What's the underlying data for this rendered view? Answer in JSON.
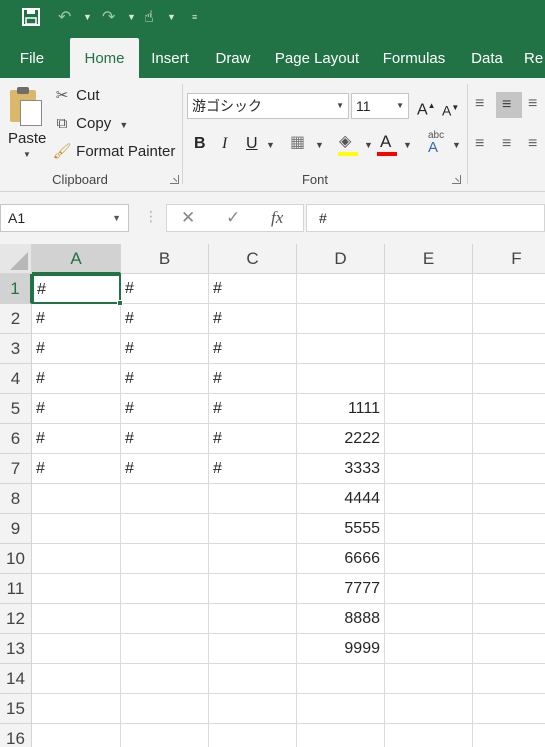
{
  "quick_access": {
    "save_icon": "save-icon",
    "undo_icon": "undo-icon",
    "redo_icon": "redo-icon",
    "touch_icon": "touch-mode-icon",
    "customize_icon": "customize-toolbar-icon"
  },
  "tabs": [
    {
      "label": "File"
    },
    {
      "label": "Home",
      "active": true
    },
    {
      "label": "Insert"
    },
    {
      "label": "Draw"
    },
    {
      "label": "Page Layout"
    },
    {
      "label": "Formulas"
    },
    {
      "label": "Data"
    },
    {
      "label": "Re"
    }
  ],
  "clipboard": {
    "paste_label": "Paste",
    "cut_label": "Cut",
    "copy_label": "Copy",
    "format_painter_label": "Format Painter",
    "group_label": "Clipboard"
  },
  "font": {
    "font_name": "游ゴシック",
    "font_size": "11",
    "bold_label": "B",
    "italic_label": "I",
    "underline_label": "U",
    "font_color_label": "A",
    "group_label": "Font",
    "highlight_color": "#ffff00",
    "font_color": "#ff0000"
  },
  "formula_bar": {
    "name_box": "A1",
    "fx_label": "fx",
    "formula": "#"
  },
  "columns": [
    "A",
    "B",
    "C",
    "D",
    "E",
    "F"
  ],
  "rows": [
    {
      "num": "1",
      "cells": [
        "#",
        "#",
        "#",
        "",
        "",
        ""
      ]
    },
    {
      "num": "2",
      "cells": [
        "#",
        "#",
        "#",
        "",
        "",
        ""
      ]
    },
    {
      "num": "3",
      "cells": [
        "#",
        "#",
        "#",
        "",
        "",
        ""
      ]
    },
    {
      "num": "4",
      "cells": [
        "#",
        "#",
        "#",
        "",
        "",
        ""
      ]
    },
    {
      "num": "5",
      "cells": [
        "#",
        "#",
        "#",
        "1111",
        "",
        ""
      ]
    },
    {
      "num": "6",
      "cells": [
        "#",
        "#",
        "#",
        "2222",
        "",
        ""
      ]
    },
    {
      "num": "7",
      "cells": [
        "#",
        "#",
        "#",
        "3333",
        "",
        ""
      ]
    },
    {
      "num": "8",
      "cells": [
        "",
        "",
        "",
        "4444",
        "",
        ""
      ]
    },
    {
      "num": "9",
      "cells": [
        "",
        "",
        "",
        "5555",
        "",
        ""
      ]
    },
    {
      "num": "10",
      "cells": [
        "",
        "",
        "",
        "6666",
        "",
        ""
      ]
    },
    {
      "num": "11",
      "cells": [
        "",
        "",
        "",
        "7777",
        "",
        ""
      ]
    },
    {
      "num": "12",
      "cells": [
        "",
        "",
        "",
        "8888",
        "",
        ""
      ]
    },
    {
      "num": "13",
      "cells": [
        "",
        "",
        "",
        "9999",
        "",
        ""
      ]
    },
    {
      "num": "14",
      "cells": [
        "",
        "",
        "",
        "",
        "",
        ""
      ]
    },
    {
      "num": "15",
      "cells": [
        "",
        "",
        "",
        "",
        "",
        ""
      ]
    },
    {
      "num": "16",
      "cells": [
        "",
        "",
        "",
        "",
        "",
        ""
      ]
    }
  ],
  "selected_cell": "A1",
  "accent_color": "#217346"
}
